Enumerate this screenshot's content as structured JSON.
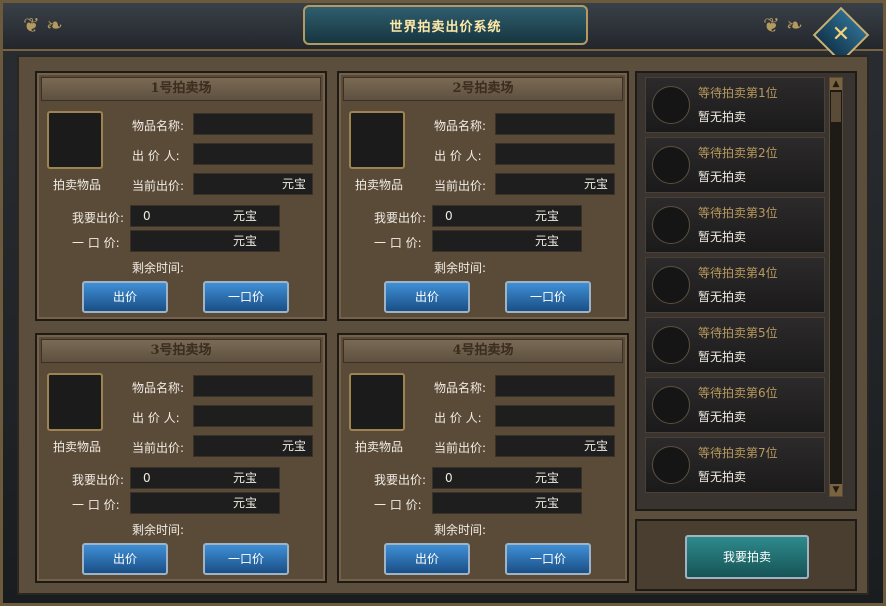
{
  "window": {
    "title": "世界拍卖出价系统"
  },
  "labels": {
    "item_name": "物品名称:",
    "bidder": "出 价 人:",
    "current_bid": "当前出价:",
    "my_bid": "我要出价:",
    "buyout": "一 口 价:",
    "remaining": "剩余时间:",
    "slot": "拍卖物品",
    "currency": "元宝"
  },
  "buttons": {
    "bid": "出价",
    "buyout": "一口价",
    "sell": "我要拍卖"
  },
  "auctions": [
    {
      "header": "1号拍卖场",
      "my_bid_value": "0"
    },
    {
      "header": "2号拍卖场",
      "my_bid_value": "0"
    },
    {
      "header": "3号拍卖场",
      "my_bid_value": "0"
    },
    {
      "header": "4号拍卖场",
      "my_bid_value": "0"
    }
  ],
  "queue": [
    {
      "title": "等待拍卖第1位",
      "status": "暂无拍卖"
    },
    {
      "title": "等待拍卖第2位",
      "status": "暂无拍卖"
    },
    {
      "title": "等待拍卖第3位",
      "status": "暂无拍卖"
    },
    {
      "title": "等待拍卖第4位",
      "status": "暂无拍卖"
    },
    {
      "title": "等待拍卖第5位",
      "status": "暂无拍卖"
    },
    {
      "title": "等待拍卖第6位",
      "status": "暂无拍卖"
    },
    {
      "title": "等待拍卖第7位",
      "status": "暂无拍卖"
    }
  ],
  "icons": {
    "close": "close-icon",
    "scroll_up": "scroll-up-icon",
    "scroll_down": "scroll-down-icon"
  }
}
